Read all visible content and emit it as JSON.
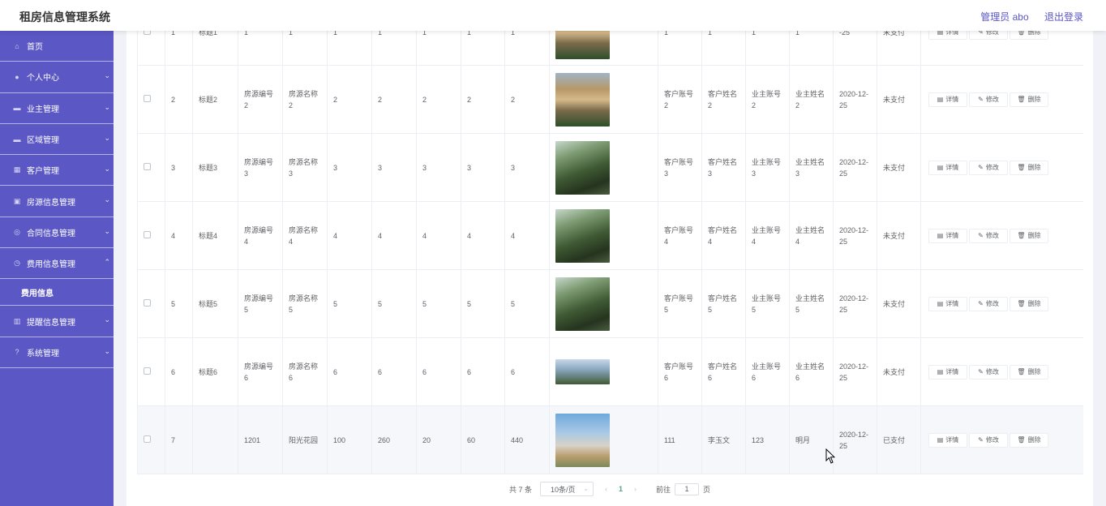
{
  "header": {
    "title": "租房信息管理系统",
    "user": "管理员 abo",
    "logout": "退出登录"
  },
  "sidebar": {
    "items": [
      {
        "label": "首页",
        "icon": "home-icon"
      },
      {
        "label": "个人中心",
        "icon": "user-icon"
      },
      {
        "label": "业主管理",
        "icon": "chat-icon"
      },
      {
        "label": "区域管理",
        "icon": "chat-icon"
      },
      {
        "label": "客户管理",
        "icon": "grid-icon"
      },
      {
        "label": "房源信息管理",
        "icon": "briefcase-icon"
      },
      {
        "label": "合同信息管理",
        "icon": "compass-icon"
      },
      {
        "label": "费用信息管理",
        "icon": "clock-icon"
      },
      {
        "label": "提醒信息管理",
        "icon": "chart-icon"
      },
      {
        "label": "系统管理",
        "icon": "help-icon"
      }
    ],
    "submenu": "费用信息"
  },
  "table": {
    "rows": [
      {
        "idx": "1",
        "title": "标题1",
        "house_no": "1",
        "house_name": "1",
        "v1": "1",
        "v2": "1",
        "v3": "1",
        "v4": "1",
        "v5": "1",
        "img": "villa",
        "cust_acc": "1",
        "cust_name": "1",
        "owner_acc": "1",
        "owner_name": "1",
        "date": "-25",
        "status": "未支付"
      },
      {
        "idx": "2",
        "title": "标题2",
        "house_no": "房源编号2",
        "house_name": "房源名称2",
        "v1": "2",
        "v2": "2",
        "v3": "2",
        "v4": "2",
        "v5": "2",
        "img": "villa",
        "cust_acc": "客户账号2",
        "cust_name": "客户姓名2",
        "owner_acc": "业主账号2",
        "owner_name": "业主姓名2",
        "date": "2020-12-25",
        "status": "未支付"
      },
      {
        "idx": "3",
        "title": "标题3",
        "house_no": "房源编号3",
        "house_name": "房源名称3",
        "v1": "3",
        "v2": "3",
        "v3": "3",
        "v4": "3",
        "v5": "3",
        "img": "forest",
        "cust_acc": "客户账号3",
        "cust_name": "客户姓名3",
        "owner_acc": "业主账号3",
        "owner_name": "业主姓名3",
        "date": "2020-12-25",
        "status": "未支付"
      },
      {
        "idx": "4",
        "title": "标题4",
        "house_no": "房源编号4",
        "house_name": "房源名称4",
        "v1": "4",
        "v2": "4",
        "v3": "4",
        "v4": "4",
        "v5": "4",
        "img": "forest",
        "cust_acc": "客户账号4",
        "cust_name": "客户姓名4",
        "owner_acc": "业主账号4",
        "owner_name": "业主姓名4",
        "date": "2020-12-25",
        "status": "未支付"
      },
      {
        "idx": "5",
        "title": "标题5",
        "house_no": "房源编号5",
        "house_name": "房源名称5",
        "v1": "5",
        "v2": "5",
        "v3": "5",
        "v4": "5",
        "v5": "5",
        "img": "forest",
        "cust_acc": "客户账号5",
        "cust_name": "客户姓名5",
        "owner_acc": "业主账号5",
        "owner_name": "业主姓名5",
        "date": "2020-12-25",
        "status": "未支付"
      },
      {
        "idx": "6",
        "title": "标题6",
        "house_no": "房源编号6",
        "house_name": "房源名称6",
        "v1": "6",
        "v2": "6",
        "v3": "6",
        "v4": "6",
        "v5": "6",
        "img": "partial",
        "cust_acc": "客户账号6",
        "cust_name": "客户姓名6",
        "owner_acc": "业主账号6",
        "owner_name": "业主姓名6",
        "date": "2020-12-25",
        "status": "未支付"
      },
      {
        "idx": "7",
        "title": "",
        "house_no": "1201",
        "house_name": "阳光花园",
        "v1": "100",
        "v2": "260",
        "v3": "20",
        "v4": "60",
        "v5": "440",
        "img": "city",
        "cust_acc": "111",
        "cust_name": "李玉文",
        "owner_acc": "123",
        "owner_name": "明月",
        "date": "2020-12-25",
        "status": "已支付"
      }
    ],
    "actions": {
      "detail": "详情",
      "edit": "修改",
      "delete": "删除"
    }
  },
  "pagination": {
    "total": "共 7 条",
    "page_size": "10条/页",
    "current_page": "1",
    "goto_label": "前往",
    "goto_value": "1",
    "page_suffix": "页"
  }
}
